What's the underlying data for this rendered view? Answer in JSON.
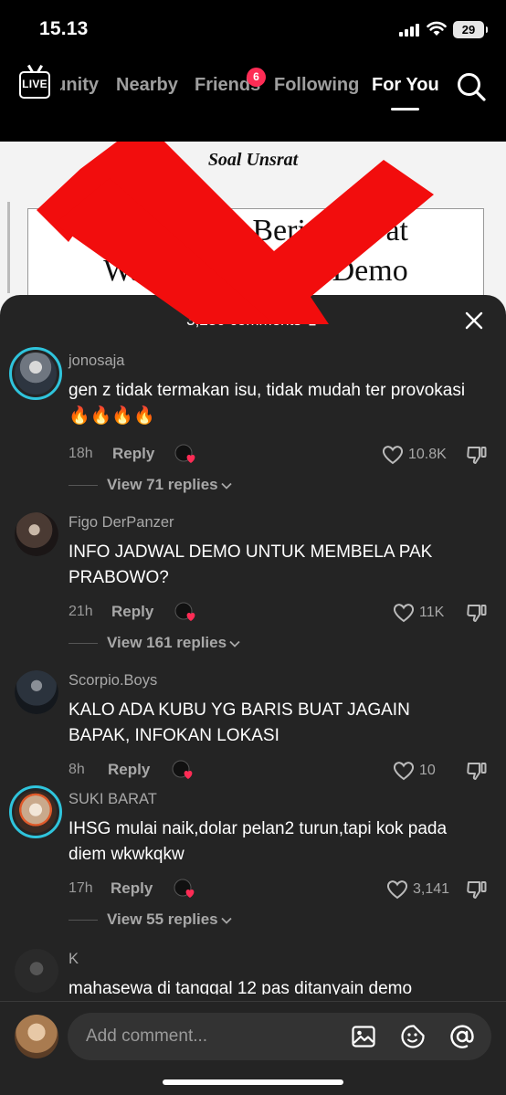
{
  "status_bar": {
    "time": "15.13",
    "battery": "29"
  },
  "top_nav": {
    "live_label": "LIVE",
    "tabs": [
      {
        "label": "unity"
      },
      {
        "label": "Nearby"
      },
      {
        "label": "Friends",
        "badge": "6"
      },
      {
        "label": "Following"
      },
      {
        "label": "For You",
        "active": true
      }
    ]
  },
  "video": {
    "caption_top": "Soal Unsrat",
    "headline_line1": "M          wa Beri T       at",
    "headline_line2": "Waktu           i       Demo"
  },
  "comments_sheet": {
    "count_label": "3,230 comments",
    "comments": [
      {
        "username": "jonosaja",
        "text": "gen z tidak termakan isu, tidak mudah ter provokasi 🔥🔥🔥🔥",
        "time": "18h",
        "reply_label": "Reply",
        "likes": "10.8K",
        "view_replies": "View 71 replies"
      },
      {
        "username": "Figo DerPanzer",
        "text": "INFO JADWAL DEMO UNTUK MEMBELA PAK PRABOWO?",
        "time": "21h",
        "reply_label": "Reply",
        "likes": "11K",
        "view_replies": "View 161 replies"
      },
      {
        "username": "Scorpio.Boys",
        "text": "KALO ADA KUBU YG BARIS BUAT JAGAIN BAPAK, INFOKAN LOKASI",
        "time": "8h",
        "reply_label": "Reply",
        "likes": "10"
      },
      {
        "username": "SUKI BARAT",
        "text": "IHSG mulai naik,dolar pelan2 turun,tapi kok pada diem wkwkqkw",
        "time": "17h",
        "reply_label": "Reply",
        "likes": "3,141",
        "view_replies": "View 55 replies"
      },
      {
        "username": "K",
        "text": "mahasewa di tanggal 12 pas ditanyain demo"
      }
    ]
  },
  "input_bar": {
    "placeholder": "Add comment..."
  },
  "colors": {
    "accent": "#fe2c55",
    "ring": "#2fc4dc",
    "sheet_bg": "#242424"
  }
}
